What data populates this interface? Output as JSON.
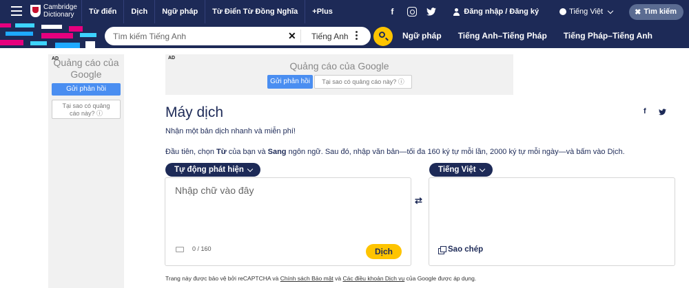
{
  "topbar": {
    "logo_line1": "Cambridge",
    "logo_line2": "Dictionary",
    "nav": [
      "Từ điển",
      "Dịch",
      "Ngữ pháp",
      "Từ Điển Từ Đồng Nghĩa",
      "+Plus"
    ],
    "social": {
      "facebook": "f",
      "twitter": "t"
    },
    "login": "Đăng nhập / Đăng ký",
    "language": "Tiếng Việt",
    "search_button": "Tìm kiếm"
  },
  "searchbar": {
    "placeholder": "Tìm kiếm Tiếng Anh",
    "clear": "✕",
    "dictionary": "Tiếng Anh",
    "links": [
      "Ngữ pháp",
      "Tiếng Anh–Tiếng Pháp",
      "Tiếng Pháp–Tiếng Anh"
    ]
  },
  "ads": {
    "label": "AD",
    "title_left": "Quảng cáo của Google",
    "title_top": "Quảng cáo của Google",
    "feedback": "Gửi phản hồi",
    "why": "Tại sao có quảng cáo này? ⓘ",
    "why_left": "Tại sao có quảng cáo này? ⓘ"
  },
  "main": {
    "title": "Máy dịch",
    "intro": "Nhận một bản dịch nhanh và miễn phí!",
    "instructions": {
      "part1": "Đầu tiên, chọn ",
      "from": "Từ",
      "part2": " của bạn và ",
      "to": "Sang",
      "part3": " ngôn ngữ. Sau đó, nhập văn bản—tối đa 160 ký tự mỗi lần, 2000 ký tự mỗi ngày—và bấm vào Dịch."
    },
    "source_lang": "Tự động phát hiện",
    "target_lang": "Tiếng Việt",
    "input_placeholder": "Nhập chữ vào đây",
    "counter": "0 / 160",
    "translate_button": "Dịch",
    "swap": "⇄",
    "copy_button": "Sao chép"
  },
  "footer": {
    "text1": "Trang này được bảo vệ bởi reCAPTCHA và ",
    "privacy": "Chính sách Bảo mật",
    "text2": " và ",
    "terms": "Các điều khoản Dịch vụ",
    "text3": " của Google được áp dụng."
  },
  "colors": {
    "navy": "#1d2a57",
    "yellow": "#fec400",
    "ad_bg": "#f1f1f1",
    "ad_blue": "#4a8ef1"
  }
}
